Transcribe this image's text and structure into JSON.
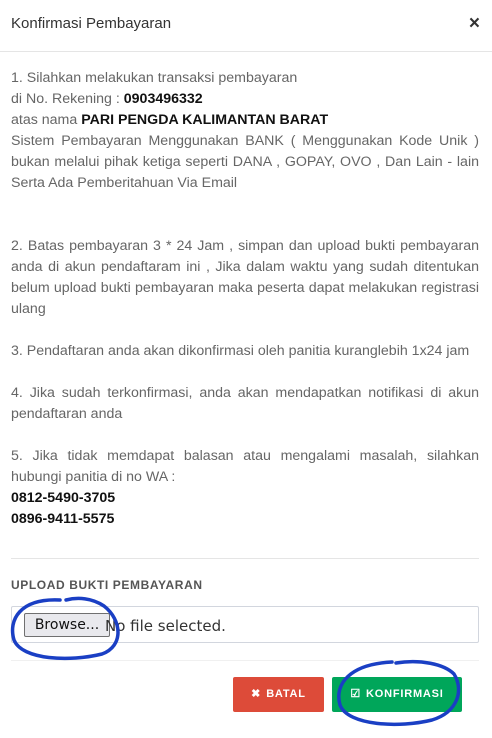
{
  "modal": {
    "title": "Konfirmasi Pembayaran",
    "close_label": "×"
  },
  "instructions": {
    "step1_line1": "1. Silahkan melakukan transaksi pembayaran",
    "step1_rek_prefix": "di No. Rekening : ",
    "step1_rek_number": "0903496332",
    "step1_name_prefix": "atas nama ",
    "step1_name": "PARI PENGDA KALIMANTAN BARAT",
    "step1_note": "Sistem Pembayaran Menggunakan BANK ( Menggunakan Kode Unik ) bukan melalui pihak ketiga seperti DANA , GOPAY, OVO , Dan Lain - lain Serta Ada Pemberitahuan Via Email",
    "step2": "2. Batas pembayaran 3 * 24 Jam , simpan dan upload bukti pembayaran anda di akun pendaftaram ini , Jika dalam waktu yang sudah ditentukan belum upload bukti pembayaran maka peserta dapat melakukan registrasi ulang",
    "step3": "3. Pendaftaran anda akan dikonfirmasi oleh panitia kuranglebih 1x24 jam",
    "step4": "4. Jika sudah terkonfirmasi, anda akan mendapatkan notifikasi di akun pendaftaran anda",
    "step5": "5. Jika tidak memdapat balasan atau mengalami masalah, silahkan hubungi panitia di no WA :",
    "phone1": "0812-5490-3705",
    "phone2": "0896-9411-5575"
  },
  "upload": {
    "label": "UPLOAD BUKTI PEMBAYARAN",
    "browse_label": "Browse...",
    "file_status": "No file selected."
  },
  "buttons": {
    "cancel_label": "BATAL",
    "cancel_icon": "times-icon",
    "confirm_label": "KONFIRMASI",
    "confirm_icon": "check-square-icon"
  },
  "colors": {
    "cancel": "#dd4b39",
    "confirm": "#00a65a",
    "annotation": "#1a3fc4"
  }
}
